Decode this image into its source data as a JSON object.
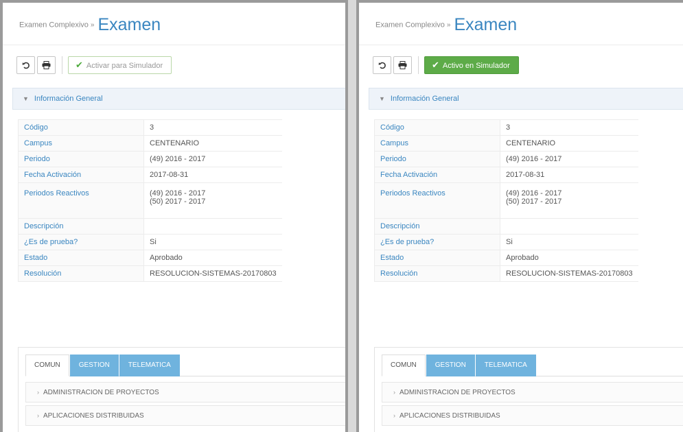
{
  "colors": {
    "title": "#3a86c0",
    "tab_blue": "#6fb3de",
    "active_green": "#5dab48",
    "section_bg": "#eef3f9"
  },
  "icons": {
    "reset": "undo-icon",
    "print": "printer-icon",
    "check": "check-icon",
    "section_toggle": "chevron-down-icon",
    "accordion_toggle": "chevron-right-icon"
  },
  "panels": [
    {
      "breadcrumb": "Examen Complexivo",
      "breadcrumb_sep": "»",
      "title": "Examen",
      "toolbar": {
        "simulator_label": "Activar para Simulador",
        "simulator_active": false
      },
      "section_title": "Información General",
      "rows": [
        {
          "label": "Código",
          "lines": [
            "3"
          ]
        },
        {
          "label": "Campus",
          "lines": [
            "CENTENARIO"
          ]
        },
        {
          "label": "Periodo",
          "lines": [
            "(49) 2016 - 2017"
          ]
        },
        {
          "label": "Fecha Activación",
          "lines": [
            "2017-08-31"
          ]
        },
        {
          "label": "Periodos Reactivos",
          "lines": [
            "(49) 2016 - 2017",
            "(50) 2017 - 2017"
          ]
        },
        {
          "label": "Descripción",
          "lines": [
            ""
          ]
        },
        {
          "label": "¿Es de prueba?",
          "lines": [
            "Si"
          ]
        },
        {
          "label": "Estado",
          "lines": [
            "Aprobado"
          ]
        },
        {
          "label": "Resolución",
          "lines": [
            "RESOLUCION-SISTEMAS-20170803"
          ]
        }
      ],
      "tabs": [
        {
          "label": "COMUN",
          "active": true
        },
        {
          "label": "GESTION",
          "active": false
        },
        {
          "label": "TELEMATICA",
          "active": false
        }
      ],
      "accordion": [
        "ADMINISTRACION DE PROYECTOS",
        "APLICACIONES DISTRIBUIDAS"
      ]
    },
    {
      "breadcrumb": "Examen Complexivo",
      "breadcrumb_sep": "»",
      "title": "Examen",
      "toolbar": {
        "simulator_label": "Activo en Simulador",
        "simulator_active": true
      },
      "section_title": "Información General",
      "rows": [
        {
          "label": "Código",
          "lines": [
            "3"
          ]
        },
        {
          "label": "Campus",
          "lines": [
            "CENTENARIO"
          ]
        },
        {
          "label": "Periodo",
          "lines": [
            "(49) 2016 - 2017"
          ]
        },
        {
          "label": "Fecha Activación",
          "lines": [
            "2017-08-31"
          ]
        },
        {
          "label": "Periodos Reactivos",
          "lines": [
            "(49) 2016 - 2017",
            "(50) 2017 - 2017"
          ]
        },
        {
          "label": "Descripción",
          "lines": [
            ""
          ]
        },
        {
          "label": "¿Es de prueba?",
          "lines": [
            "Si"
          ]
        },
        {
          "label": "Estado",
          "lines": [
            "Aprobado"
          ]
        },
        {
          "label": "Resolución",
          "lines": [
            "RESOLUCION-SISTEMAS-20170803"
          ]
        }
      ],
      "tabs": [
        {
          "label": "COMUN",
          "active": true
        },
        {
          "label": "GESTION",
          "active": false
        },
        {
          "label": "TELEMATICA",
          "active": false
        }
      ],
      "accordion": [
        "ADMINISTRACION DE PROYECTOS",
        "APLICACIONES DISTRIBUIDAS"
      ]
    }
  ]
}
